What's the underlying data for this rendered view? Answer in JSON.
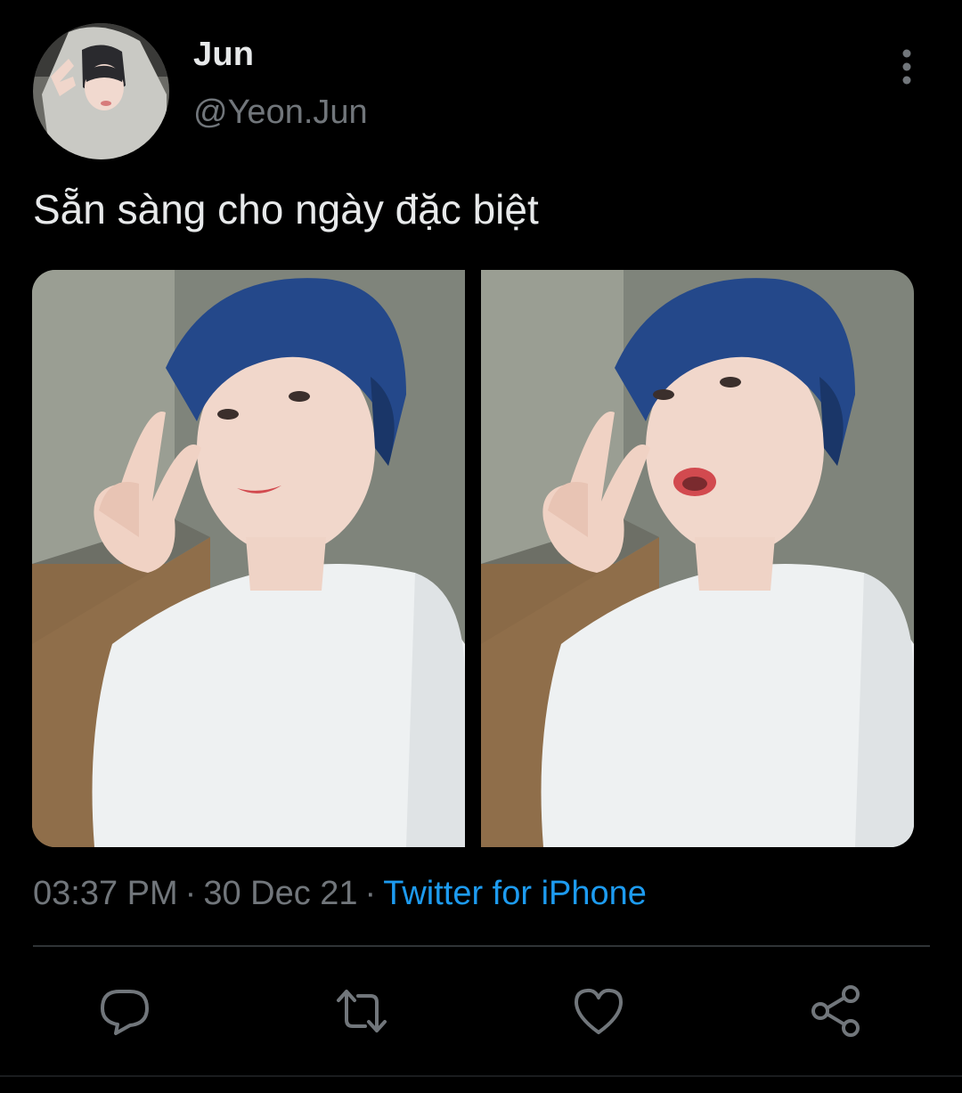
{
  "tweet": {
    "author": {
      "display_name": "Jun",
      "handle": "@Yeon.Jun",
      "avatar_icon": "profile-avatar"
    },
    "text": "Sẵn sàng cho ngày đặc biệt",
    "media_count": 2,
    "time": "03:37 PM",
    "date": "30 Dec 21",
    "separator": "·",
    "source": "Twitter for iPhone"
  },
  "actions": [
    {
      "icon": "reply-icon"
    },
    {
      "icon": "retweet-icon"
    },
    {
      "icon": "like-icon"
    },
    {
      "icon": "share-icon"
    }
  ],
  "colors": {
    "background": "#000000",
    "text_primary": "#e7e9ea",
    "text_secondary": "#71767b",
    "link": "#1d9bf0",
    "divider": "#2f3336"
  }
}
